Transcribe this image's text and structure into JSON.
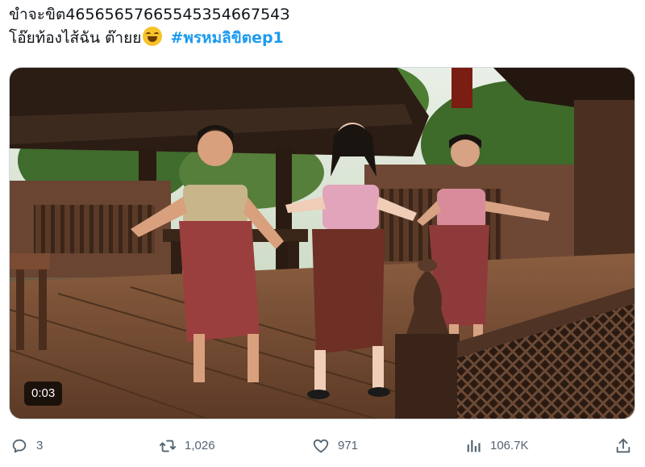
{
  "post": {
    "line1": "ขำจะขิต4656565766554535466754З",
    "line2_text": "โอ๊ยท้องไส้ฉัน ต๊ายย",
    "line2_emoji": "rolling-on-floor-laughing-emoji",
    "hashtag": "#พรหมลิขิตep1"
  },
  "media": {
    "duration": "0:03"
  },
  "actions": {
    "replies": "3",
    "retweets": "1,026",
    "likes": "971",
    "views": "106.7K"
  },
  "colors": {
    "text": "#0f1419",
    "hashtag": "#1d9bf0",
    "action": "#536471"
  }
}
